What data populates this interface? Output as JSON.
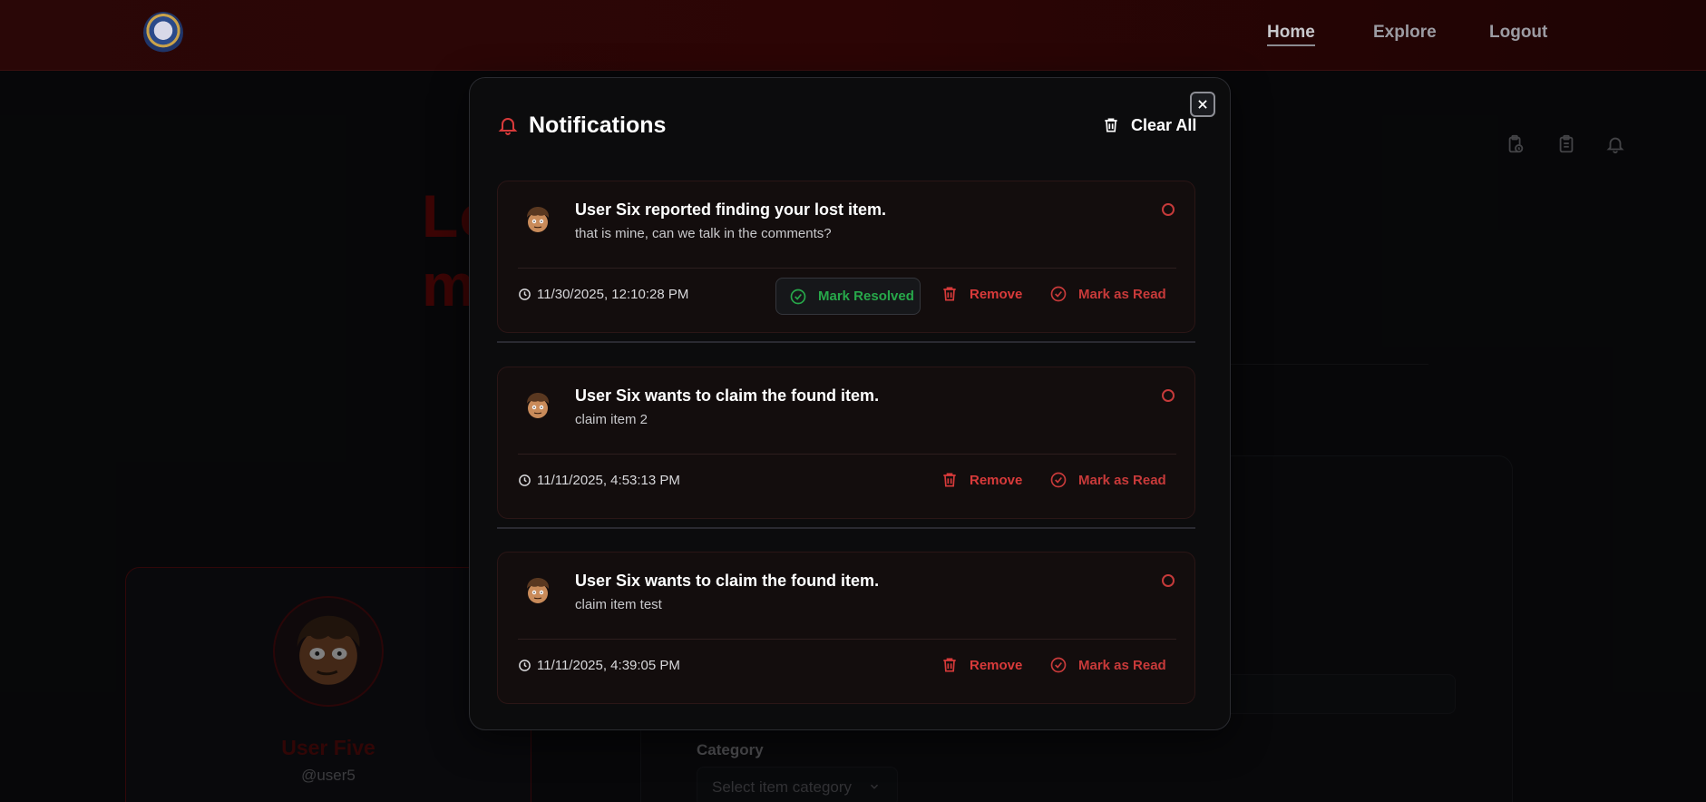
{
  "nav": {
    "home": "Home",
    "explore": "Explore",
    "logout": "Logout"
  },
  "background": {
    "title_left": "Lo",
    "title_right": "m",
    "profile": {
      "name": "User Five",
      "handle": "@user5"
    },
    "form": {
      "category_label": "Category",
      "category_placeholder": "Select item category"
    }
  },
  "modal": {
    "title": "Notifications",
    "clear_all": "Clear All",
    "notifications": [
      {
        "title": "User Six reported finding your lost item.",
        "body": "that is mine, can we talk in the comments?",
        "timestamp": "11/30/2025, 12:10:28 PM",
        "resolve_label": "Mark Resolved",
        "remove_label": "Remove",
        "read_label": "Mark as Read"
      },
      {
        "title": "User Six wants to claim the found item.",
        "body": "claim item 2",
        "timestamp": "11/11/2025, 4:53:13 PM",
        "remove_label": "Remove",
        "read_label": "Mark as Read"
      },
      {
        "title": "User Six wants to claim the found item.",
        "body": "claim item test",
        "timestamp": "11/11/2025, 4:39:05 PM",
        "remove_label": "Remove",
        "read_label": "Mark as Read"
      }
    ]
  },
  "colors": {
    "accent_red": "#d83a3a",
    "resolved_green": "#27a84a",
    "modal_bg": "#0c0c0d",
    "card_bg": "#130d0d"
  },
  "icons": {
    "header": "bell-icon",
    "clear": "trash-icon",
    "close": "close-icon",
    "time": "clock-icon",
    "resolve": "check-circle-icon",
    "remove": "trash-icon",
    "read": "check-circle-icon"
  }
}
